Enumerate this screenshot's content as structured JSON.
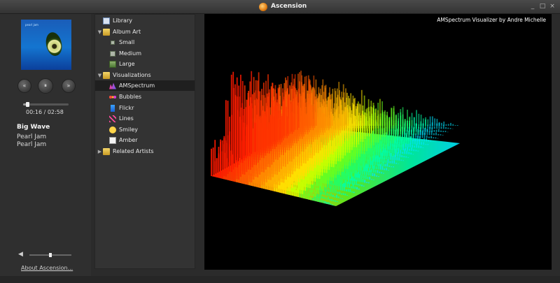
{
  "window": {
    "title": "Ascension",
    "controls": [
      "_",
      "□",
      "×"
    ]
  },
  "album_art": {
    "band_text": "pearl jam"
  },
  "player": {
    "controls": {
      "prev": "«",
      "pause": "⏸",
      "next": "»"
    },
    "progress": 0.09,
    "time": "00:16 / 02:58",
    "track": "Big Wave",
    "artist": "Pearl Jam",
    "album": "Pearl Jam",
    "volume": 0.5,
    "volume_icon": "speaker-icon",
    "about_link": "About Ascension..."
  },
  "tree": {
    "items": [
      {
        "label": "Library",
        "icon": "library-icon",
        "arrow": ""
      },
      {
        "label": "Album Art",
        "icon": "folder-icon",
        "arrow": "▼"
      },
      {
        "label": "Small",
        "icon": "small-image-icon",
        "arrow": ""
      },
      {
        "label": "Medium",
        "icon": "medium-image-icon",
        "arrow": ""
      },
      {
        "label": "Large",
        "icon": "large-image-icon",
        "arrow": ""
      },
      {
        "label": "Visualizations",
        "icon": "folder-icon",
        "arrow": "▼"
      },
      {
        "label": "AMSpectrum",
        "icon": "spectrum-icon",
        "arrow": "",
        "selected": true
      },
      {
        "label": "Bubbles",
        "icon": "bubbles-icon",
        "arrow": ""
      },
      {
        "label": "Flickr",
        "icon": "flickr-icon",
        "arrow": ""
      },
      {
        "label": "Lines",
        "icon": "lines-icon",
        "arrow": ""
      },
      {
        "label": "Smiley",
        "icon": "smiley-icon",
        "arrow": ""
      },
      {
        "label": "Amber",
        "icon": "page-icon",
        "arrow": ""
      },
      {
        "label": "Related Artists",
        "icon": "folder-icon",
        "arrow": "▶"
      }
    ]
  },
  "visualizer": {
    "caption": "AMSpectrum Visualizer by Andre Michelle"
  }
}
